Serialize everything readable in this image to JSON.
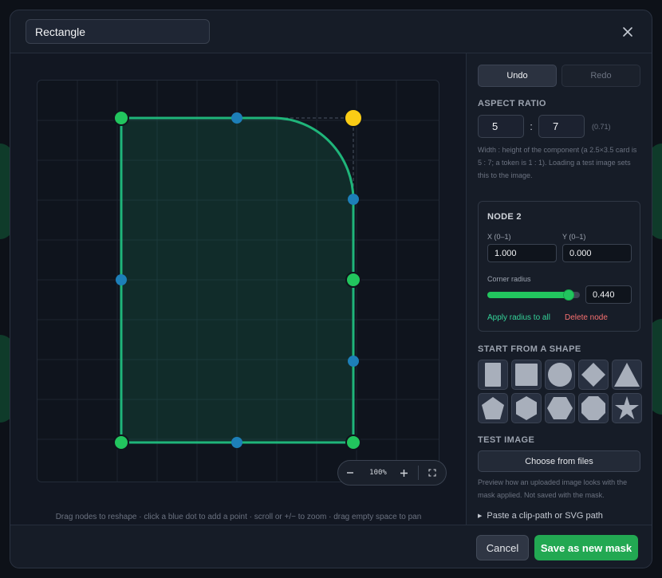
{
  "modal": {
    "name_value": "Rectangle",
    "close_icon": "close-icon"
  },
  "toolbar": {
    "undo_label": "Undo",
    "redo_label": "Redo"
  },
  "aspect_ratio": {
    "title": "ASPECT RATIO",
    "width": "5",
    "height": "7",
    "separator": ":",
    "computed": "(0.71)",
    "help": "Width : height of the component (a 2.5×3.5 card is 5 : 7; a token is 1 : 1). Loading a test image sets this to the image."
  },
  "node": {
    "title": "NODE 2",
    "x_label": "X (0–1)",
    "y_label": "Y (0–1)",
    "x_value": "1.000",
    "y_value": "0.000",
    "radius_label": "Corner radius",
    "radius_value": "0.440",
    "radius_level": 0.88,
    "apply_label": "Apply radius to all",
    "delete_label": "Delete node"
  },
  "shapes": {
    "title": "START FROM A SHAPE",
    "items": [
      "portrait-rectangle-icon",
      "square-icon",
      "circle-icon",
      "diamond-icon",
      "triangle-icon",
      "pentagon-icon",
      "hexagon-icon",
      "wide-hexagon-icon",
      "octagon-icon",
      "star-icon"
    ]
  },
  "test_image": {
    "title": "TEST IMAGE",
    "button_label": "Choose from files",
    "help": "Preview how an uploaded image looks with the mask applied. Not saved with the mask."
  },
  "paste": {
    "label": "Paste a clip-path or SVG path"
  },
  "canvas": {
    "zoom_label": "100%",
    "hint": "Drag nodes to reshape · click a blue dot to add a point · scroll or +/− to zoom · drag empty space to pan",
    "colors": {
      "outline": "#1fb57a",
      "node": "#22c55e",
      "selected_node": "#facc15",
      "midpoint": "#1d7fb8"
    }
  },
  "footer": {
    "cancel_label": "Cancel",
    "save_label": "Save as new mask"
  }
}
